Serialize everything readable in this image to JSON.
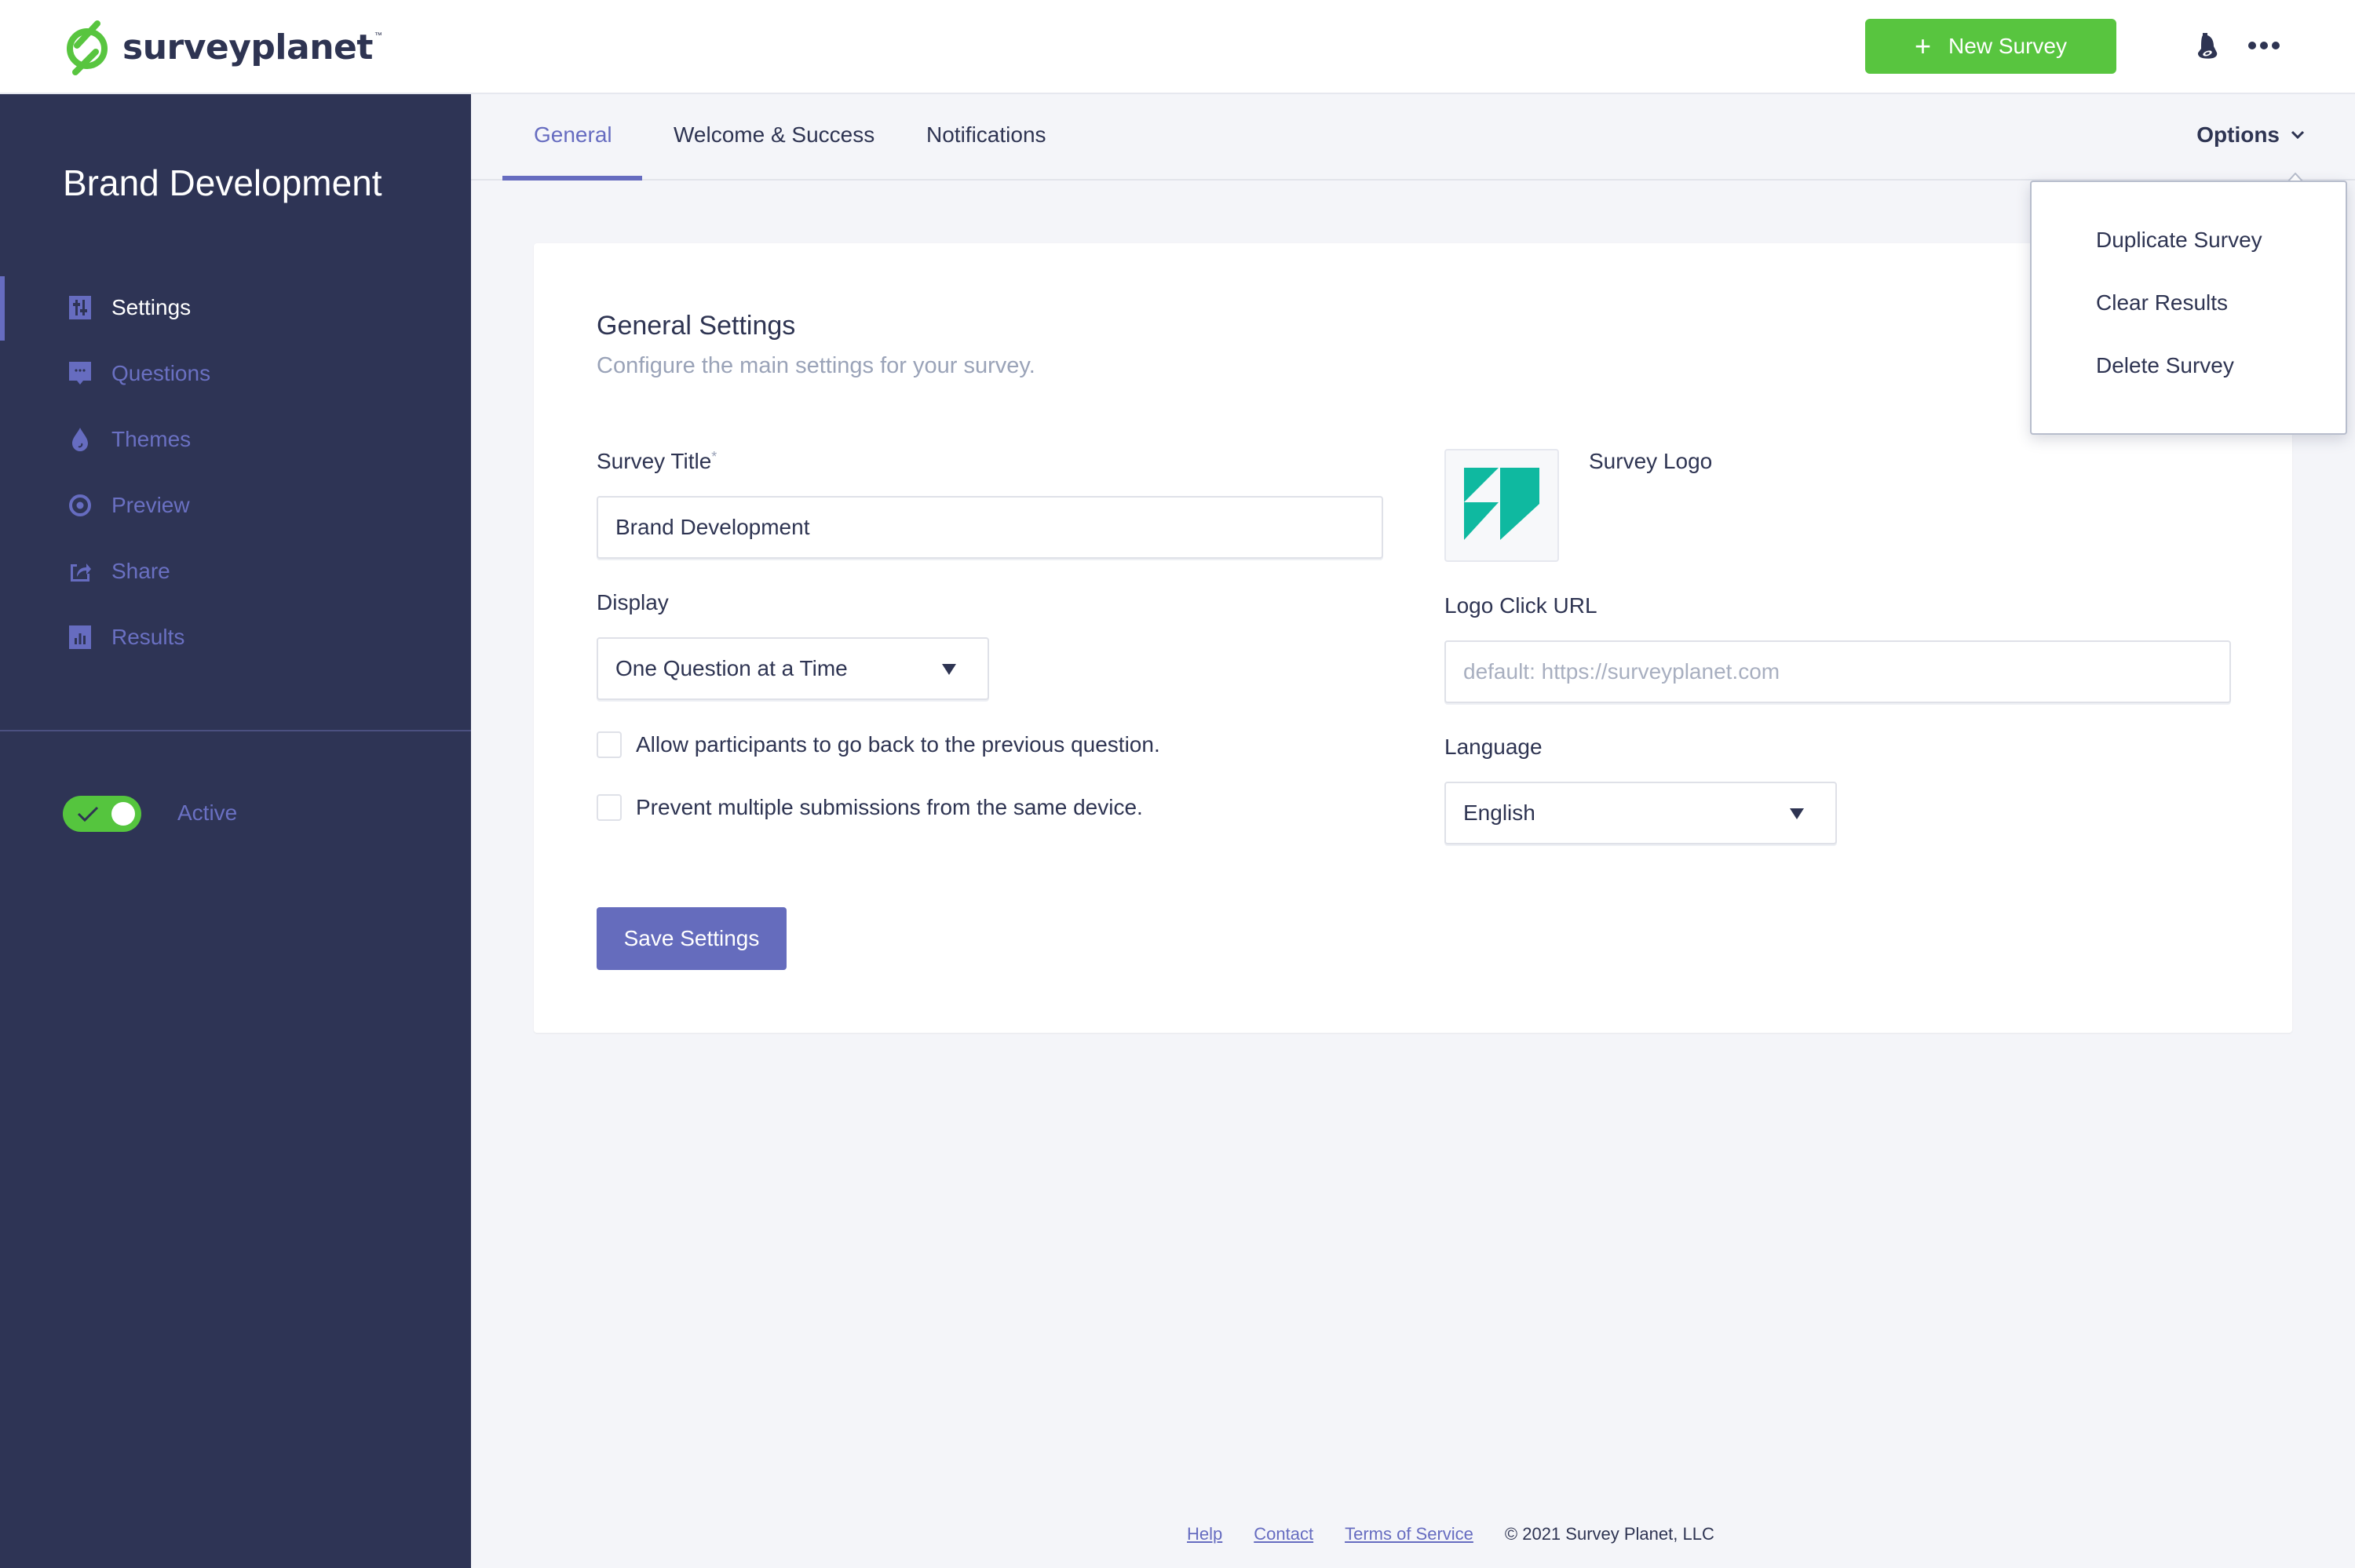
{
  "header": {
    "brand_name": "surveyplanet",
    "brand_tm": "™",
    "new_survey_label": "New Survey",
    "new_survey_icon": "plus-icon",
    "icons": [
      "bell-icon",
      "more-icon"
    ],
    "colors": {
      "brand_green": "#58c53f",
      "accent": "#666cc0",
      "sidebar_bg": "#2e3455"
    }
  },
  "sidebar": {
    "survey_title": "Brand Development",
    "items": [
      {
        "label": "Settings",
        "icon": "sliders-icon",
        "active": true
      },
      {
        "label": "Questions",
        "icon": "speech-bubble-icon",
        "active": false
      },
      {
        "label": "Themes",
        "icon": "droplet-icon",
        "active": false
      },
      {
        "label": "Preview",
        "icon": "eye-icon",
        "active": false
      },
      {
        "label": "Share",
        "icon": "share-icon",
        "active": false
      },
      {
        "label": "Results",
        "icon": "bar-chart-icon",
        "active": false
      }
    ],
    "status_toggle": {
      "label": "Active",
      "on": true
    }
  },
  "tabs": {
    "items": [
      {
        "label": "General",
        "active": true
      },
      {
        "label": "Welcome & Success",
        "active": false
      },
      {
        "label": "Notifications",
        "active": false
      }
    ],
    "options_label": "Options"
  },
  "options_menu": {
    "items": [
      "Duplicate Survey",
      "Clear Results",
      "Delete Survey"
    ]
  },
  "settings": {
    "title": "General Settings",
    "subtitle": "Configure the main settings for your survey.",
    "survey_title_label": "Survey Title",
    "required_mark": "*",
    "survey_title_value": "Brand Development",
    "display_label": "Display",
    "display_value": "One Question at a Time",
    "checkboxes": [
      {
        "label": "Allow participants to go back to the previous question.",
        "checked": false
      },
      {
        "label": "Prevent multiple submissions from the same device.",
        "checked": false
      }
    ],
    "survey_logo_label": "Survey Logo",
    "logo_click_url_label": "Logo Click URL",
    "logo_click_url_value": "",
    "logo_click_url_placeholder": "default: https://surveyplanet.com",
    "language_label": "Language",
    "language_value": "English",
    "save_label": "Save Settings"
  },
  "footer": {
    "links": [
      "Help",
      "Contact",
      "Terms of Service"
    ],
    "copyright": "© 2021 Survey Planet, LLC"
  }
}
